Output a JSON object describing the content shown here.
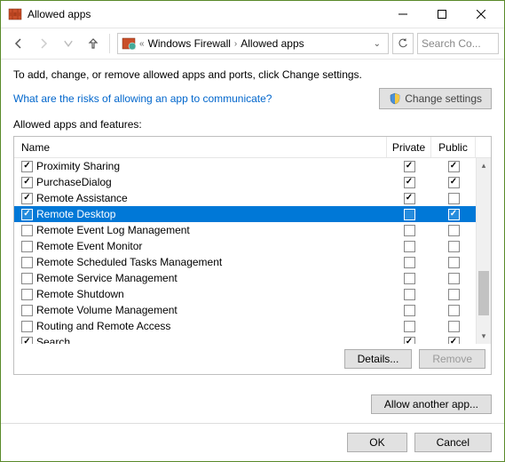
{
  "window": {
    "title": "Allowed apps",
    "min": "Minimize",
    "max": "Maximize",
    "close": "Close"
  },
  "nav": {
    "back": "Back",
    "forward": "Forward",
    "up": "Up",
    "crumbs": [
      "Windows Firewall",
      "Allowed apps"
    ],
    "refresh": "Refresh",
    "search_placeholder": "Search Co..."
  },
  "instruction": "To add, change, or remove allowed apps and ports, click Change settings.",
  "risks_link": "What are the risks of allowing an app to communicate?",
  "change_settings": "Change settings",
  "group_label": "Allowed apps and features:",
  "columns": {
    "name": "Name",
    "private": "Private",
    "public": "Public"
  },
  "apps": [
    {
      "name": "Proximity Sharing",
      "allowed": true,
      "private": true,
      "public": true,
      "selected": false
    },
    {
      "name": "PurchaseDialog",
      "allowed": true,
      "private": true,
      "public": true,
      "selected": false
    },
    {
      "name": "Remote Assistance",
      "allowed": true,
      "private": true,
      "public": false,
      "selected": false
    },
    {
      "name": "Remote Desktop",
      "allowed": true,
      "private": false,
      "public": true,
      "selected": true
    },
    {
      "name": "Remote Event Log Management",
      "allowed": false,
      "private": false,
      "public": false,
      "selected": false
    },
    {
      "name": "Remote Event Monitor",
      "allowed": false,
      "private": false,
      "public": false,
      "selected": false
    },
    {
      "name": "Remote Scheduled Tasks Management",
      "allowed": false,
      "private": false,
      "public": false,
      "selected": false
    },
    {
      "name": "Remote Service Management",
      "allowed": false,
      "private": false,
      "public": false,
      "selected": false
    },
    {
      "name": "Remote Shutdown",
      "allowed": false,
      "private": false,
      "public": false,
      "selected": false
    },
    {
      "name": "Remote Volume Management",
      "allowed": false,
      "private": false,
      "public": false,
      "selected": false
    },
    {
      "name": "Routing and Remote Access",
      "allowed": false,
      "private": false,
      "public": false,
      "selected": false
    },
    {
      "name": "Search",
      "allowed": true,
      "private": true,
      "public": true,
      "selected": false
    }
  ],
  "buttons": {
    "details": "Details...",
    "remove": "Remove",
    "allow_another": "Allow another app...",
    "ok": "OK",
    "cancel": "Cancel"
  }
}
